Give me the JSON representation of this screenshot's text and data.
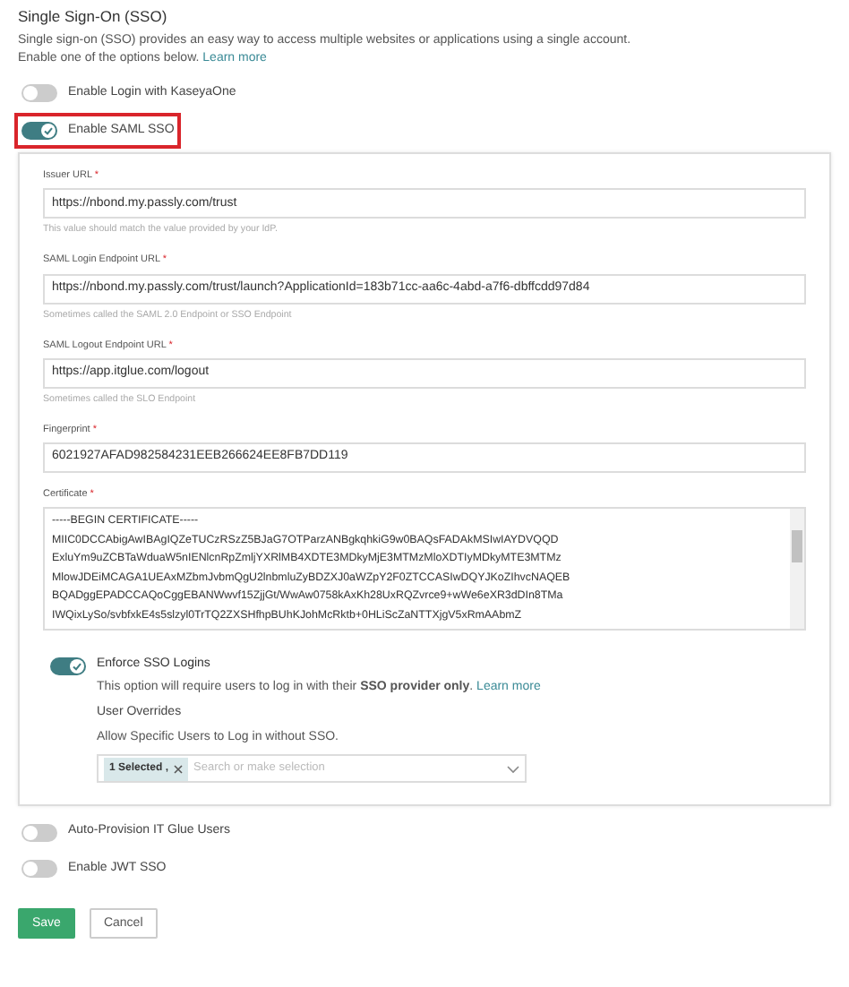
{
  "title": "Single Sign-On (SSO)",
  "description_lines": [
    "Single sign-on (SSO) provides an easy way to access multiple websites or applications using a single account.",
    "Enable one of the options below."
  ],
  "learn_more": "Learn more",
  "options": [
    {
      "label": "Enable Login with KaseyaOne",
      "on": false,
      "highlighted": false
    },
    {
      "label": "Enable SAML SSO",
      "on": true,
      "highlighted": true
    }
  ],
  "saml": {
    "fields": [
      {
        "kind": "input",
        "label": "Issuer URL",
        "required": "*",
        "value": "https://nbond.my.passly.com/trust",
        "hint": "This value should match the value provided by your IdP."
      },
      {
        "kind": "input",
        "label": "SAML Login Endpoint URL",
        "required": "*",
        "value": "https://nbond.my.passly.com/trust/launch?ApplicationId=183b71cc-aa6c-4abd-a7f6-dbffcdd97d84",
        "hint": "Sometimes called the SAML 2.0 Endpoint or SSO Endpoint"
      },
      {
        "kind": "input",
        "label": "SAML Logout Endpoint URL",
        "required": "*",
        "value": "https://app.itglue.com/logout",
        "hint": "Sometimes called the SLO Endpoint"
      },
      {
        "kind": "input",
        "label": "Fingerprint",
        "required": "*",
        "value": "6021927AFAD982584231EEB266624EE8FB7DD119"
      },
      {
        "kind": "textarea",
        "label": "Certificate",
        "required": "*",
        "lines": [
          "-----BEGIN CERTIFICATE-----",
          "MIIC0DCCAbigAwIBAgIQZeTUCzRSzZ5BJaG7OTParzANBgkqhkiG9w0BAQsFADAkMSIwIAYDVQQD",
          "ExluYm9uZCBTaWduaW5nIENlcnRpZmljYXRlMB4XDTE3MDkyMjE3MTMzMloXDTIyMDkyMTE3MTMz",
          "MlowJDEiMCAGA1UEAxMZbmJvbmQgU2lnbmluZyBDZXJ0aWZpY2F0ZTCCASIwDQYJKoZIhvcNAQEB",
          "BQADggEPADCCAQoCggEBANWwvf15ZjjGt/WwAw0758kAxKh28UxRQZvrce9+wWe6eXR3dDIn8TMa",
          "IWQixLySo/svbfxkE4s5slzyl0TrTQ2ZXSHfhpBUhKJohMcRktb+0HLiScZaNTTXjgV5xRmAAbmZ"
        ]
      }
    ],
    "enforce": {
      "label": "Enforce SSO Logins",
      "on": true,
      "description": "This option will require users to log in with their **SSO provider only**.",
      "learn_more": "Learn more"
    },
    "overrides": {
      "title": "User Overrides",
      "description": "Allow Specific Users to Log in without SSO.",
      "chip": "1 Selected ,",
      "placeholder": "Search or make selection"
    }
  },
  "more_options": [
    {
      "label": "Auto-Provision IT Glue Users",
      "on": false
    },
    {
      "label": "Enable JWT SSO",
      "on": false
    }
  ],
  "buttons": [
    {
      "kind": "primary",
      "label": "Save"
    },
    {
      "kind": "secondary",
      "label": "Cancel"
    }
  ]
}
